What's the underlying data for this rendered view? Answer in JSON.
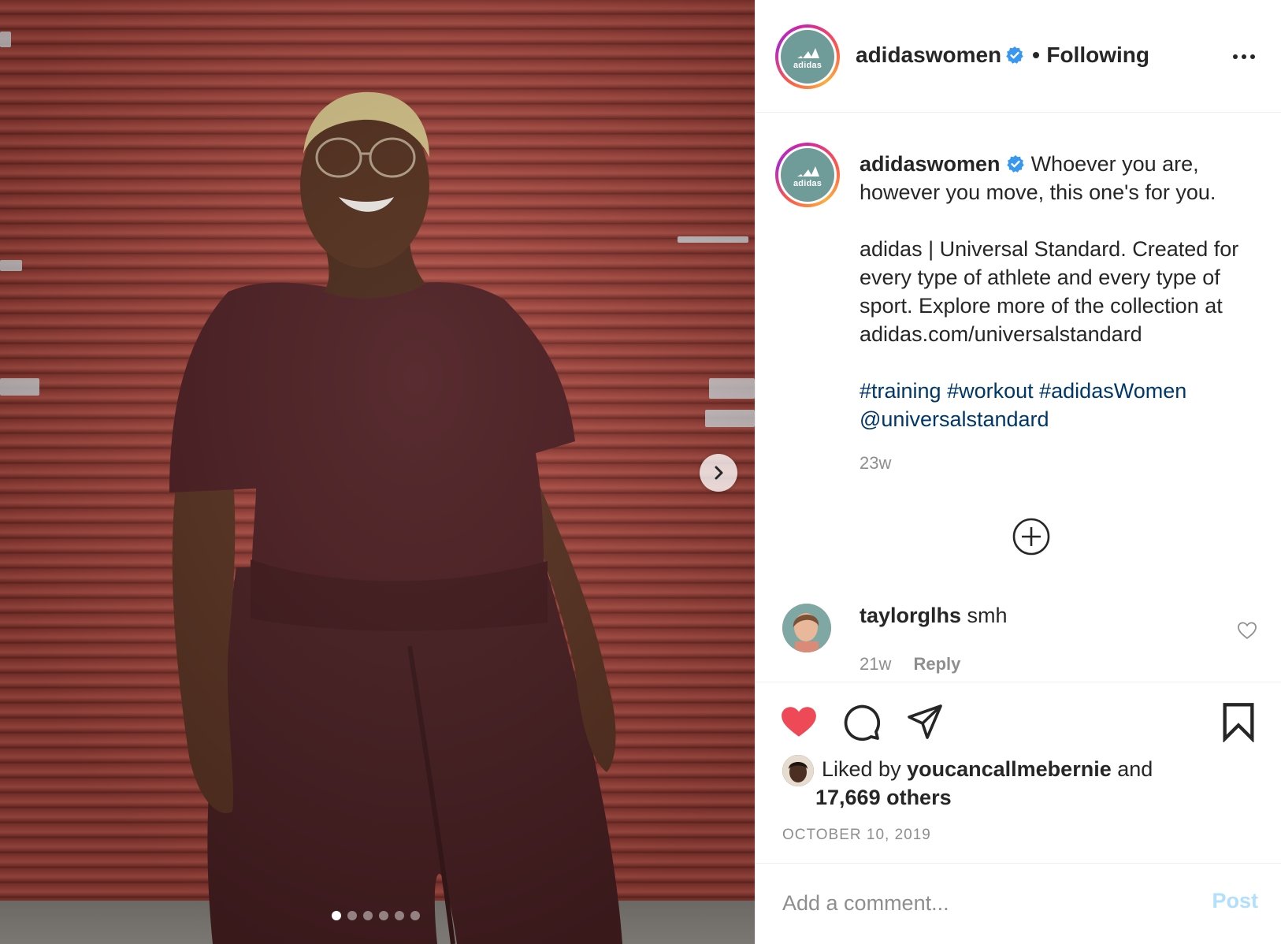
{
  "post": {
    "username": "adidaswomen",
    "verified": true,
    "follow_status": "Following",
    "separator": "•",
    "brand_logo_text": "adidas",
    "caption": {
      "line1": "Whoever you are, however you move, this one's for you.",
      "paragraph2": "adidas | Universal Standard. Created for every type of athlete and every type of sport. Explore more of the collection at adidas.com/universalstandard",
      "hashtags": "#training #workout #adidasWomen",
      "mention": "@universalstandard"
    },
    "caption_age": "23w",
    "media": {
      "carousel_count": 6,
      "carousel_active_index": 0
    },
    "comments": [
      {
        "username": "taylorglhs",
        "text": "smh",
        "age": "21w",
        "reply_label": "Reply"
      }
    ],
    "likes": {
      "prefix": "Liked by",
      "first_liker": "youcancallmebernie",
      "joiner": "and",
      "others": "17,669 others",
      "liked_by_viewer": true
    },
    "date": "OCTOBER 10, 2019",
    "comment_box": {
      "placeholder": "Add a comment...",
      "post_label": "Post"
    }
  },
  "colors": {
    "heart": "#ed4956",
    "verified": "#3897f0",
    "link": "#00376b",
    "post_disabled": "#b2dffc",
    "muted": "#8e8e8e"
  },
  "icons": [
    "chevron-right-icon",
    "more-dots-icon",
    "verified-badge-icon",
    "add-circle-icon",
    "heart-outline-icon",
    "heart-filled-icon",
    "comment-icon",
    "share-icon",
    "bookmark-icon"
  ]
}
